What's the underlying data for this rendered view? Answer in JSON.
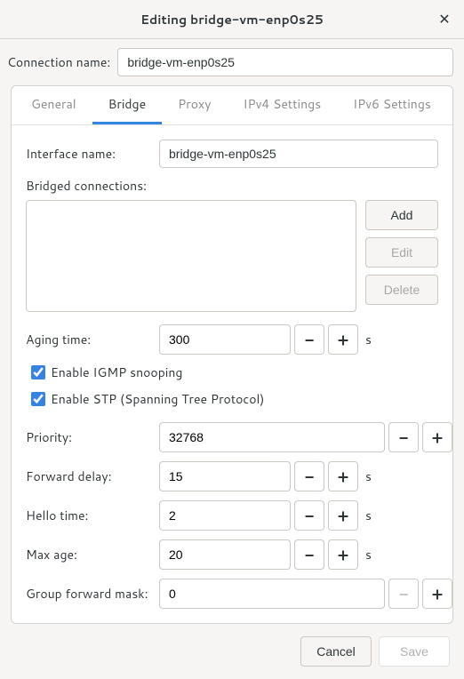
{
  "titlebar": {
    "title": "Editing bridge-vm-enp0s25"
  },
  "connName": {
    "label": "Connection name:",
    "value": "bridge-vm-enp0s25"
  },
  "tabs": {
    "general": "General",
    "bridge": "Bridge",
    "proxy": "Proxy",
    "ipv4": "IPv4 Settings",
    "ipv6": "IPv6 Settings"
  },
  "bridge": {
    "interfaceName": {
      "label": "Interface name:",
      "value": "bridge-vm-enp0s25"
    },
    "bridgedConns": {
      "label": "Bridged connections:"
    },
    "buttons": {
      "add": "Add",
      "edit": "Edit",
      "delete": "Delete"
    },
    "agingTime": {
      "label": "Aging time:",
      "value": "300",
      "unit": "s"
    },
    "igmp": "Enable IGMP snooping",
    "stp": "Enable STP (Spanning Tree Protocol)",
    "priority": {
      "label": "Priority:",
      "value": "32768"
    },
    "forwardDelay": {
      "label": "Forward delay:",
      "value": "15",
      "unit": "s"
    },
    "helloTime": {
      "label": "Hello time:",
      "value": "2",
      "unit": "s"
    },
    "maxAge": {
      "label": "Max age:",
      "value": "20",
      "unit": "s"
    },
    "groupForwardMask": {
      "label": "Group forward mask:",
      "value": "0"
    }
  },
  "footer": {
    "cancel": "Cancel",
    "save": "Save"
  }
}
